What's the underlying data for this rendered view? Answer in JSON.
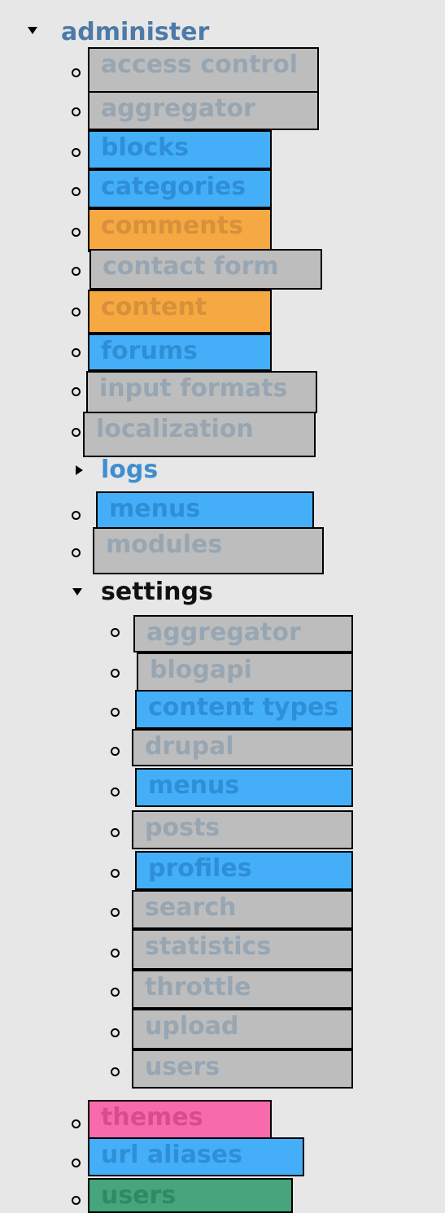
{
  "menu": {
    "administer": "administer",
    "access_control": "access control",
    "aggregator": "aggregator",
    "blocks": "blocks",
    "categories": "categories",
    "comments": "comments",
    "contact_form": "contact form",
    "content": "content",
    "forums": "forums",
    "input_formats": "input formats",
    "localization": "localization",
    "logs": "logs",
    "menus": "menus",
    "modules": "modules",
    "settings": "settings",
    "settings_items": {
      "aggregator": "aggregator",
      "blogapi": "blogapi",
      "content_types": "content types",
      "drupal": "drupal",
      "menus": "menus",
      "posts": "posts",
      "profiles": "profiles",
      "search": "search",
      "statistics": "statistics",
      "throttle": "throttle",
      "upload": "upload",
      "users": "users"
    },
    "themes": "themes",
    "url_aliases": "url aliases",
    "users": "users"
  },
  "colors": {
    "background": "#e7e7e7",
    "gray": "#bdbdbd",
    "blue": "#44aff8",
    "orange": "#f6a843",
    "pink": "#f76aac",
    "green": "#46a57a",
    "administer_text": "#4d7aa8",
    "logs_text": "#3f8ed1",
    "settings_text": "#111111"
  },
  "icons": {
    "expanded": "triangle-down-icon",
    "collapsed": "triangle-right-icon",
    "bullet": "circle-bullet-icon"
  }
}
